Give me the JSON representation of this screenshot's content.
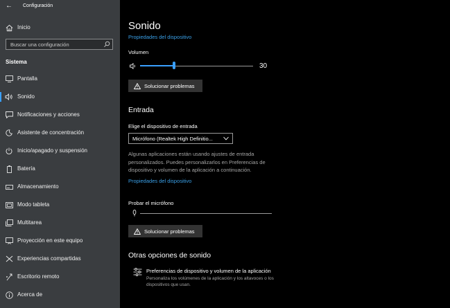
{
  "window": {
    "title": "Configuración"
  },
  "sidebar": {
    "home_label": "Inicio",
    "search": {
      "placeholder": "Buscar una configuración"
    },
    "section_title": "Sistema",
    "items": [
      {
        "label": "Pantalla",
        "icon": "monitor-icon"
      },
      {
        "label": "Sonido",
        "icon": "speaker-icon",
        "active": true
      },
      {
        "label": "Notificaciones y acciones",
        "icon": "notification-icon"
      },
      {
        "label": "Asistente de concentración",
        "icon": "moon-icon"
      },
      {
        "label": "Inicio/apagado y suspensión",
        "icon": "power-icon"
      },
      {
        "label": "Batería",
        "icon": "battery-icon"
      },
      {
        "label": "Almacenamiento",
        "icon": "storage-icon"
      },
      {
        "label": "Modo tableta",
        "icon": "tablet-icon"
      },
      {
        "label": "Multitarea",
        "icon": "multitask-icon"
      },
      {
        "label": "Proyección en este equipo",
        "icon": "projection-icon"
      },
      {
        "label": "Experiencias compartidas",
        "icon": "shared-icon"
      },
      {
        "label": "Escritorio remoto",
        "icon": "remote-icon"
      },
      {
        "label": "Acerca de",
        "icon": "info-icon"
      }
    ]
  },
  "main": {
    "title": "Sonido",
    "device_properties_link": "Propiedades del dispositivo",
    "volume": {
      "label": "Volumen",
      "value": 30,
      "value_text": "30"
    },
    "troubleshoot_label": "Solucionar problemas",
    "input": {
      "heading": "Entrada",
      "choose_label": "Elige el dispositivo de entrada",
      "selected_device": "Micrófono (Realtek High Definitio...",
      "note": "Algunas aplicaciones están usando ajustes de entrada personalizados. Puedes personalizarlos en Preferencias de dispositivo y volumen de la aplicación a continuación.",
      "properties_link": "Propiedades del dispositivo",
      "test_label": "Probar el micrófono",
      "mic_level": 0,
      "troubleshoot_label": "Solucionar problemas"
    },
    "other": {
      "heading": "Otras opciones de sonido",
      "app_prefs_title": "Preferencias de dispositivo y volumen de la aplicación",
      "app_prefs_desc": "Personaliza los volúmenes de la aplicación y los altavoces o los dispositivos que usan."
    }
  },
  "colors": {
    "accent": "#3aa0ff",
    "link": "#3aa0e8",
    "sidebar_bg": "#3a3d40",
    "main_bg": "#000000"
  }
}
